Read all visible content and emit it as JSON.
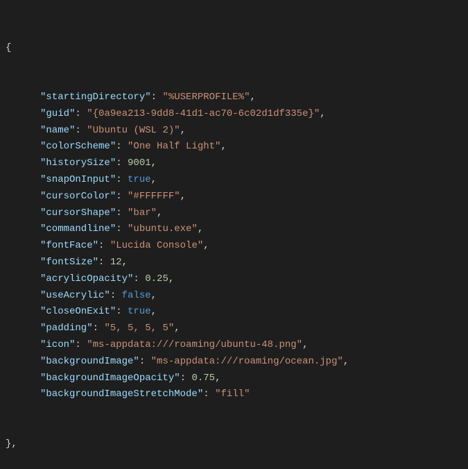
{
  "code": {
    "open_brace": "{",
    "close_brace": "},",
    "colon": ": ",
    "comma": ",",
    "quote": "\"",
    "props": [
      {
        "key": "startingDirectory",
        "value": "%USERPROFILE%",
        "type": "string"
      },
      {
        "key": "guid",
        "value": "{0a9ea213-9dd8-41d1-ac70-6c02d1df335e}",
        "type": "string"
      },
      {
        "key": "name",
        "value": "Ubuntu (WSL 2)",
        "type": "string"
      },
      {
        "key": "colorScheme",
        "value": "One Half Light",
        "type": "string"
      },
      {
        "key": "historySize",
        "value": "9001",
        "type": "number"
      },
      {
        "key": "snapOnInput",
        "value": "true",
        "type": "bool"
      },
      {
        "key": "cursorColor",
        "value": "#FFFFFF",
        "type": "string"
      },
      {
        "key": "cursorShape",
        "value": "bar",
        "type": "string"
      },
      {
        "key": "commandline",
        "value": "ubuntu.exe",
        "type": "string"
      },
      {
        "key": "fontFace",
        "value": "Lucida Console",
        "type": "string"
      },
      {
        "key": "fontSize",
        "value": "12",
        "type": "number"
      },
      {
        "key": "acrylicOpacity",
        "value": "0.25",
        "type": "number"
      },
      {
        "key": "useAcrylic",
        "value": "false",
        "type": "bool"
      },
      {
        "key": "closeOnExit",
        "value": "true",
        "type": "bool"
      },
      {
        "key": "padding",
        "value": "5, 5, 5, 5",
        "type": "string"
      },
      {
        "key": "icon",
        "value": "ms-appdata:///roaming/ubuntu-48.png",
        "type": "string"
      },
      {
        "key": "backgroundImage",
        "value": "ms-appdata:///roaming/ocean.jpg",
        "type": "string"
      },
      {
        "key": "backgroundImageOpacity",
        "value": "0.75",
        "type": "number"
      },
      {
        "key": "backgroundImageStretchMode",
        "value": "fill",
        "type": "string",
        "last": true
      }
    ]
  }
}
